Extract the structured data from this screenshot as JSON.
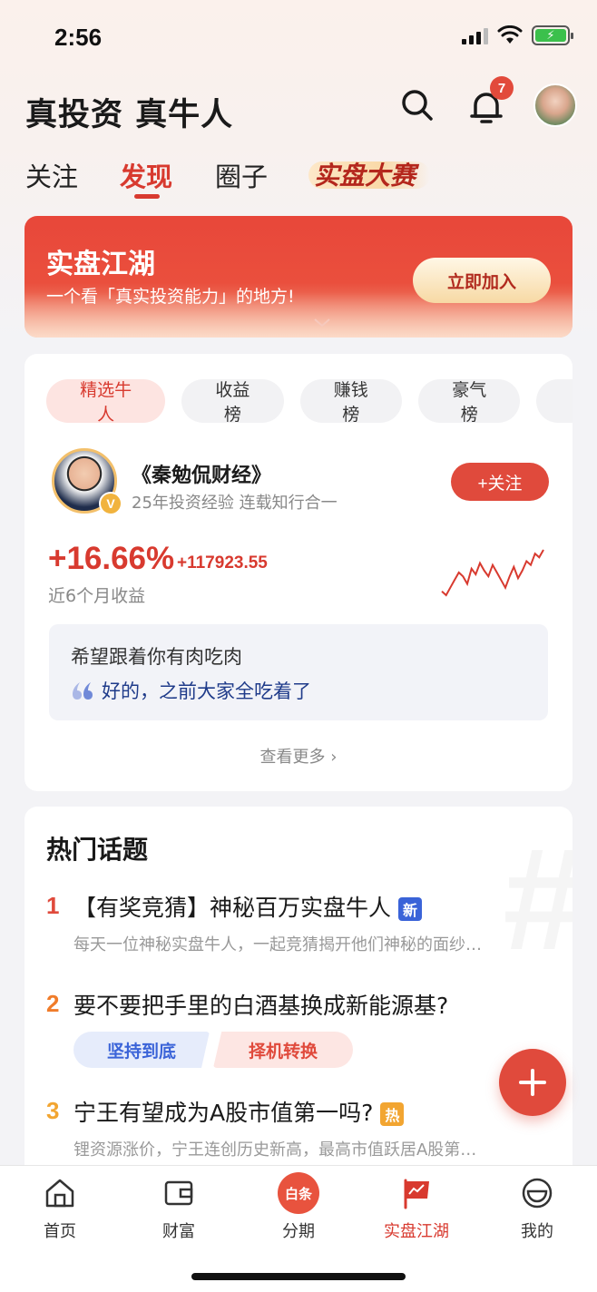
{
  "status_bar": {
    "time": "2:56"
  },
  "header": {
    "title": "真投资 真牛人",
    "notification_count": "7"
  },
  "tabs": [
    {
      "label": "关注"
    },
    {
      "label": "发现"
    },
    {
      "label": "圈子"
    },
    {
      "label": "实盘大赛"
    }
  ],
  "banner": {
    "title": "实盘江湖",
    "subtitle": "一个看「真实投资能力」的地方!",
    "button": "立即加入"
  },
  "ranking": {
    "chips": [
      {
        "label": "精选牛人"
      },
      {
        "label": "收益榜"
      },
      {
        "label": "赚钱榜"
      },
      {
        "label": "豪气榜"
      }
    ],
    "user": {
      "name": "《秦勉侃财经》",
      "desc": "25年投资经验 连载知行合一",
      "follow": "+关注",
      "return_pct": "+16.66%",
      "return_amount": "+117923.55",
      "return_label": "近6个月收益",
      "badge": "V"
    },
    "sparkline": [
      20,
      18,
      22,
      26,
      30,
      28,
      24,
      32,
      29,
      35,
      31,
      28,
      34,
      30,
      26,
      22,
      28,
      33,
      27,
      31,
      36,
      34,
      40,
      38,
      42
    ],
    "quote_line1": "希望跟着你有肉吃肉",
    "quote_line2": "好的，之前大家全吃着了",
    "see_more": "查看更多"
  },
  "hot_topics": {
    "title": "热门话题",
    "items": [
      {
        "rank": "1",
        "title": "【有奖竞猜】神秘百万实盘牛人",
        "tag": "新",
        "sub": "每天一位神秘实盘牛人，一起竞猜揭开他们神秘的面纱…"
      },
      {
        "rank": "2",
        "title": "要不要把手里的白酒基换成新能源基?",
        "vote_a": "坚持到底",
        "vote_b": "择机转换"
      },
      {
        "rank": "3",
        "title": "宁王有望成为A股市值第一吗?",
        "tag": "热",
        "sub": "锂资源涨价，宁王连创历史新高，最高市值跃居A股第…"
      }
    ]
  },
  "bottom_nav": [
    {
      "label": "首页"
    },
    {
      "label": "财富"
    },
    {
      "label": "分期",
      "icon_text": "白条"
    },
    {
      "label": "实盘江湖"
    },
    {
      "label": "我的"
    }
  ],
  "colors": {
    "accent": "#d83a2f",
    "blue": "#3a63d8",
    "gold": "#f2a531"
  }
}
